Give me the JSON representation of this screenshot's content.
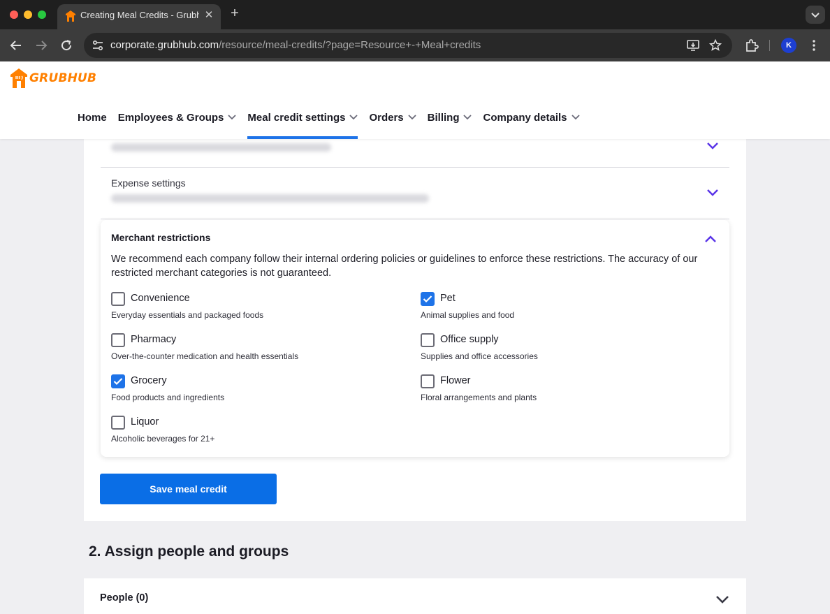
{
  "browser": {
    "tab_title": "Creating Meal Credits - Grubh",
    "url_domain": "corporate.grubhub.com",
    "url_path": "/resource/meal-credits/?page=Resource+-+Meal+credits",
    "profile_initial": "K"
  },
  "site": {
    "logo_text": "GRUBHUB",
    "nav": [
      {
        "label": "Home",
        "has_dropdown": false,
        "active": false
      },
      {
        "label": "Employees & Groups",
        "has_dropdown": true,
        "active": false
      },
      {
        "label": "Meal credit settings",
        "has_dropdown": true,
        "active": true
      },
      {
        "label": "Orders",
        "has_dropdown": true,
        "active": false
      },
      {
        "label": "Billing",
        "has_dropdown": true,
        "active": false
      },
      {
        "label": "Company details",
        "has_dropdown": true,
        "active": false
      }
    ]
  },
  "settings": {
    "expense_title": "Expense settings",
    "merchant": {
      "title": "Merchant restrictions",
      "description": "We recommend each company follow their internal ordering policies or guidelines to enforce these restrictions. The accuracy of our restricted merchant categories is not guaranteed.",
      "options": [
        {
          "label": "Convenience",
          "sub": "Everyday essentials and packaged foods",
          "checked": false
        },
        {
          "label": "Pet",
          "sub": "Animal supplies and food",
          "checked": true
        },
        {
          "label": "Pharmacy",
          "sub": "Over-the-counter medication and health essentials",
          "checked": false
        },
        {
          "label": "Office supply",
          "sub": "Supplies and office accessories",
          "checked": false
        },
        {
          "label": "Grocery",
          "sub": "Food products and ingredients",
          "checked": true
        },
        {
          "label": "Flower",
          "sub": "Floral arrangements and plants",
          "checked": false
        },
        {
          "label": "Liquor",
          "sub": "Alcoholic beverages for 21+",
          "checked": false
        }
      ]
    },
    "save_label": "Save meal credit"
  },
  "assign": {
    "heading": "2. Assign people and groups",
    "people_label": "People (0)"
  },
  "colors": {
    "brand_orange": "#ff8000",
    "primary_blue": "#0a6ee6",
    "chevron_purple": "#5a35e8"
  }
}
